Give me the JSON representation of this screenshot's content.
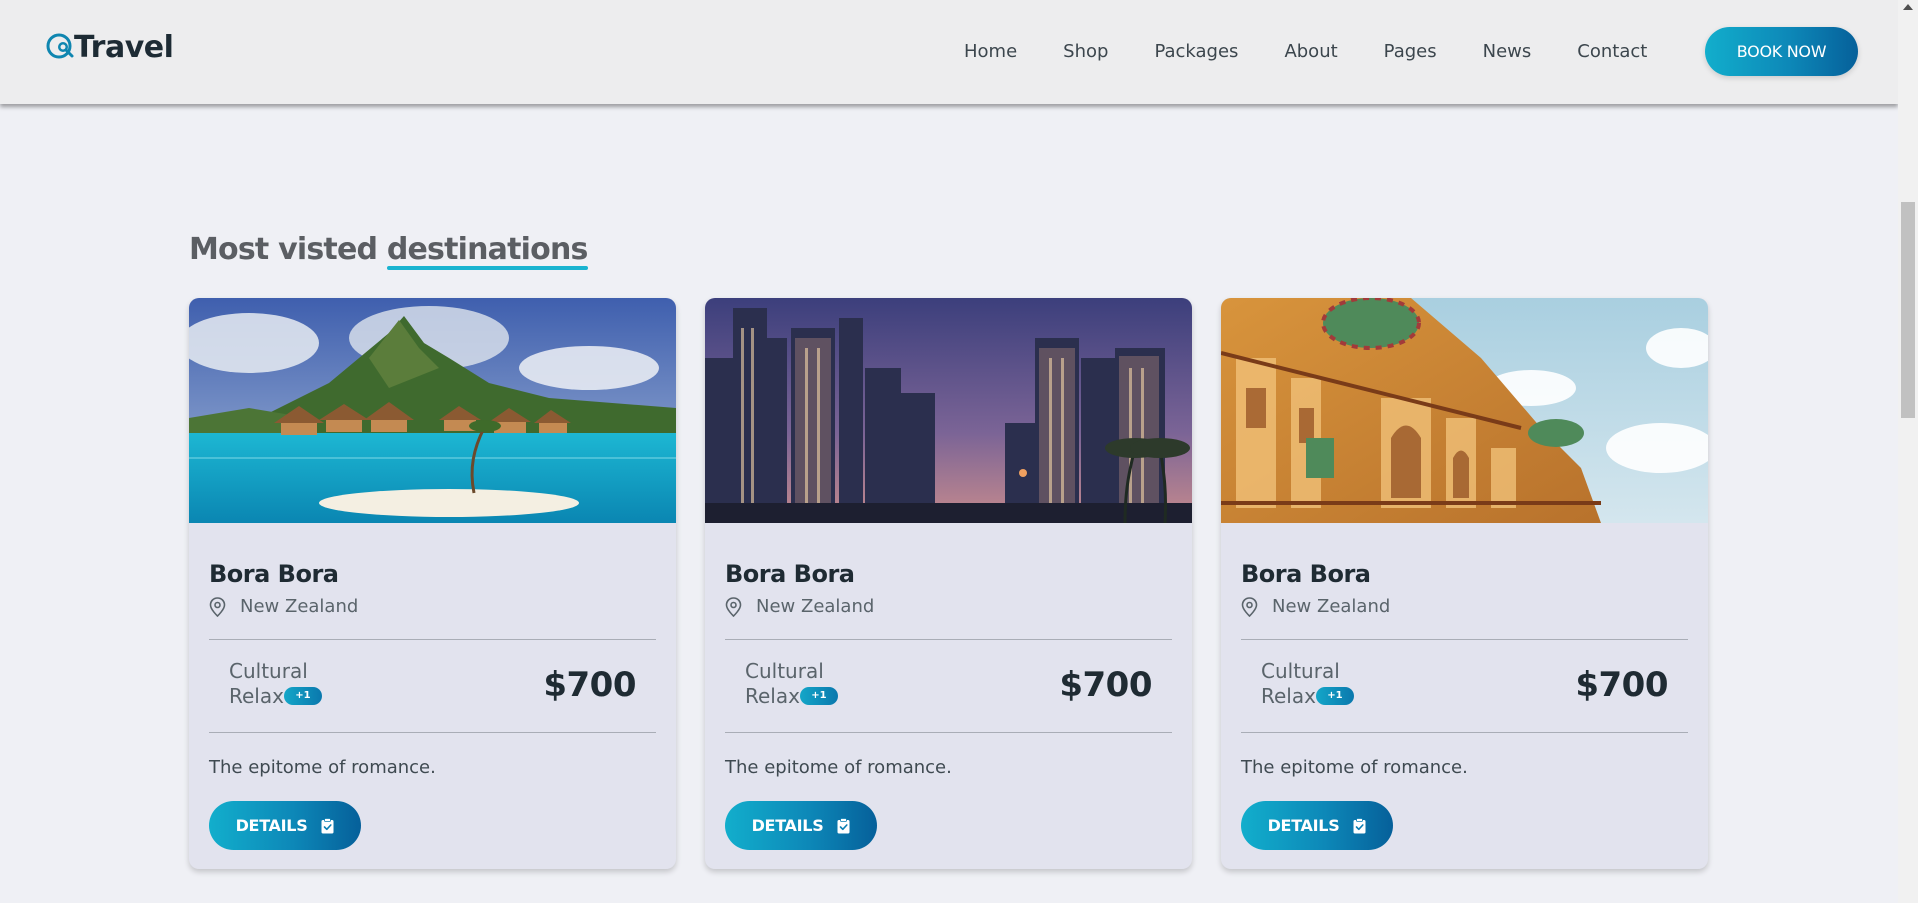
{
  "header": {
    "logo_text": "Travel",
    "nav": [
      "Home",
      "Shop",
      "Packages",
      "About",
      "Pages",
      "News",
      "Contact"
    ],
    "cta_label": "BOOK NOW"
  },
  "section": {
    "title_prefix": "Most visted ",
    "title_highlight": "destinations",
    "accent_color": "#19b3d0"
  },
  "cards": [
    {
      "title": "Bora Bora",
      "location": "New Zealand",
      "tag_1": "Cultural",
      "tag_2": "Relax",
      "tag_more": "+1",
      "price": "$700",
      "description": "The epitome of romance.",
      "button": "DETAILS",
      "image": "tropical island overwater bungalows"
    },
    {
      "title": "Bora Bora",
      "location": "New Zealand",
      "tag_1": "Cultural",
      "tag_2": "Relax",
      "tag_more": "+1",
      "price": "$700",
      "description": "The epitome of romance.",
      "button": "DETAILS",
      "image": "city skyline skyscrapers at dusk"
    },
    {
      "title": "Bora Bora",
      "location": "New Zealand",
      "tag_1": "Cultural",
      "tag_2": "Relax",
      "tag_more": "+1",
      "price": "$700",
      "description": "The epitome of romance.",
      "button": "DETAILS",
      "image": "ornate palace facade"
    }
  ],
  "icons": {
    "logo": "globe-search-icon",
    "location": "map-pin-icon",
    "details": "clipboard-check-icon"
  },
  "colors": {
    "brand_gradient_start": "#12aecc",
    "brand_gradient_end": "#06609a",
    "page_background": "#eff0f5",
    "card_background": "#e2e3ee"
  }
}
